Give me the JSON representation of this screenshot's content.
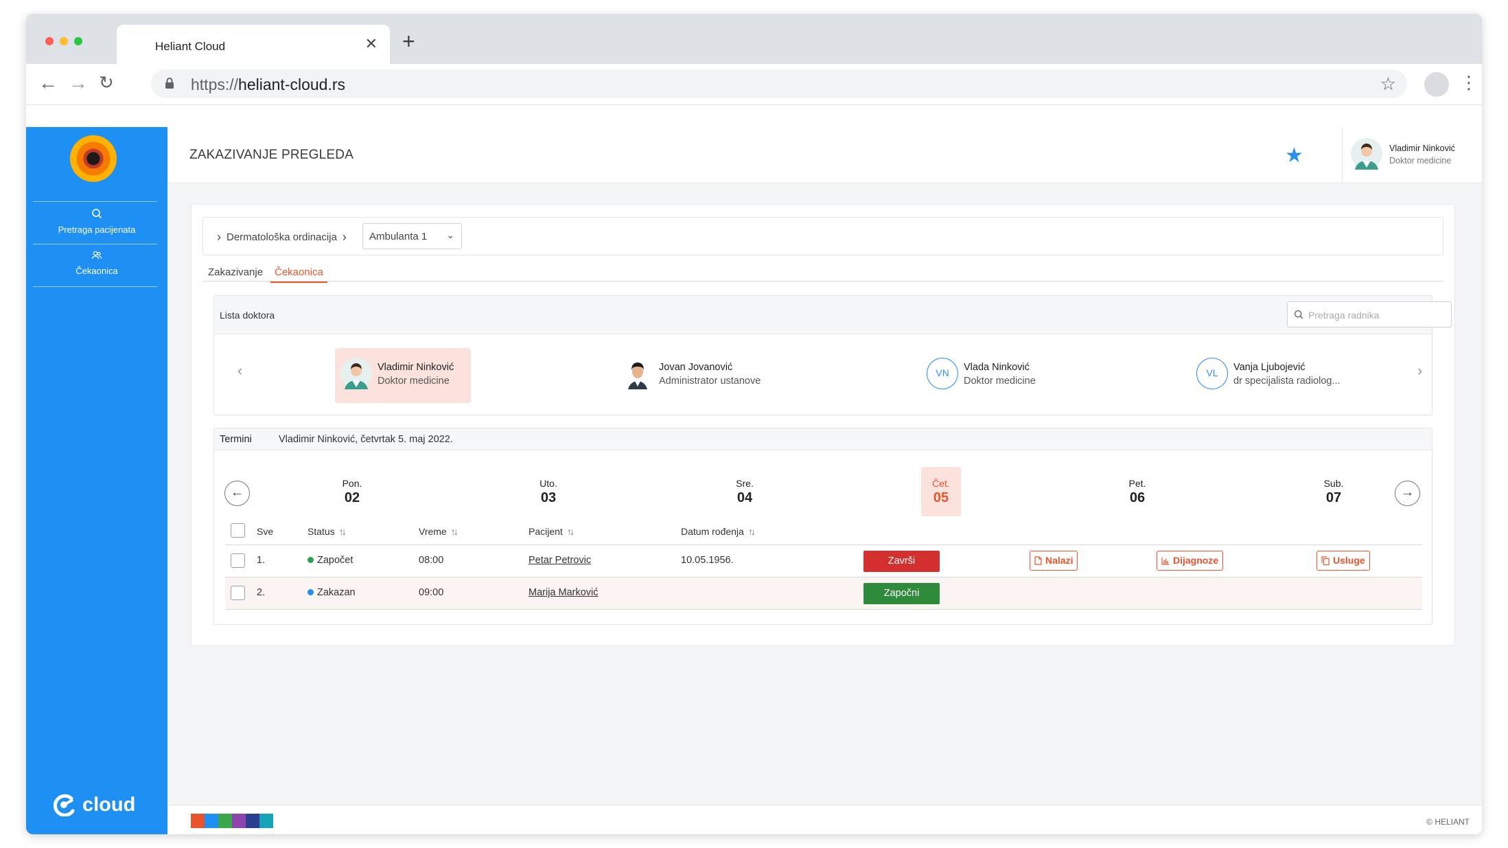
{
  "browser": {
    "tab_title": "Heliant Cloud",
    "url_protocol": "https://",
    "url_host": "heliant-cloud.rs"
  },
  "sidebar": {
    "items": [
      {
        "label": "Pretraga pacijenata",
        "icon": "search-icon"
      },
      {
        "label": "Čekaonica",
        "icon": "people-icon"
      }
    ],
    "brand": "cloud"
  },
  "header": {
    "title": "ZAKAZIVANJE PREGLEDA",
    "user_name": "Vladimir Ninković",
    "user_role": "Doktor medicine"
  },
  "breadcrumb": {
    "clinic": "Dermatološka ordinacija",
    "ambulance": "Ambulanta 1"
  },
  "tabs": [
    {
      "label": "Zakazivanje",
      "active": false
    },
    {
      "label": "Čekaonica",
      "active": true
    }
  ],
  "doctors_panel": {
    "title": "Lista doktora",
    "search_placeholder": "Pretraga radnika",
    "doctors": [
      {
        "name": "Vladimir Ninković",
        "role": "Doktor medicine",
        "selected": true
      },
      {
        "name": "Jovan Jovanović",
        "role": "Administrator ustanove",
        "selected": false
      },
      {
        "name": "Vlada Ninković",
        "role": "Doktor medicine",
        "initials": "VN",
        "selected": false
      },
      {
        "name": "Vanja Ljubojević",
        "role": "dr specijalista radiolog...",
        "initials": "VL",
        "selected": false
      }
    ]
  },
  "appointments": {
    "title": "Termini",
    "subtitle": "Vladimir Ninković, četvrtak 5. maj 2022.",
    "days": [
      {
        "name": "Pon.",
        "num": "02",
        "active": false
      },
      {
        "name": "Uto.",
        "num": "03",
        "active": false
      },
      {
        "name": "Sre.",
        "num": "04",
        "active": false
      },
      {
        "name": "Čet.",
        "num": "05",
        "active": true
      },
      {
        "name": "Pet.",
        "num": "06",
        "active": false
      },
      {
        "name": "Sub.",
        "num": "07",
        "active": false
      }
    ],
    "columns": {
      "all": "Sve",
      "status": "Status",
      "time": "Vreme",
      "patient": "Pacijent",
      "dob": "Datum rođenja"
    },
    "rows": [
      {
        "index": "1.",
        "status": "Započet",
        "status_color": "#2e9e4f",
        "time": "08:00",
        "patient": "Petar Petrovic",
        "dob": "10.05.1956.",
        "action": "Završi",
        "action_color": "#d32f2f",
        "nalazi": "Nalazi",
        "dijagnoze": "Dijagnoze",
        "usluge": "Usluge"
      },
      {
        "index": "2.",
        "status": "Zakazan",
        "status_color": "#1e8ff3",
        "time": "09:00",
        "patient": "Marija Marković",
        "dob": "",
        "action": "Započni",
        "action_color": "#2e8b3b"
      }
    ]
  },
  "footer": {
    "copyright": "© HELIANT"
  }
}
